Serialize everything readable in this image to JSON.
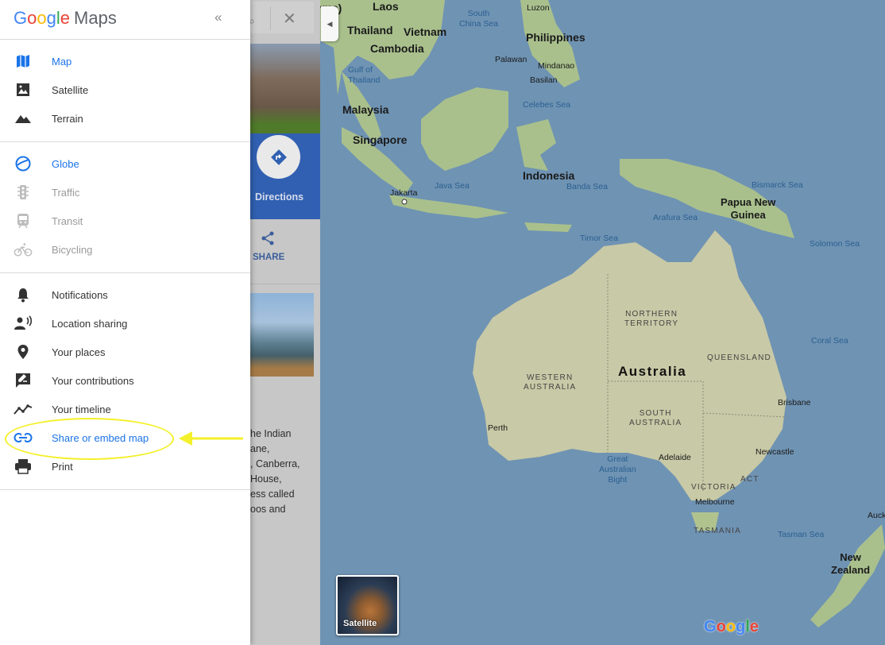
{
  "drawer": {
    "logo_google": [
      "G",
      "o",
      "o",
      "g",
      "l",
      "e"
    ],
    "logo_maps": "Maps",
    "collapse_icon": "«",
    "map_types": [
      {
        "label": "Map",
        "icon": "map-icon",
        "active": true
      },
      {
        "label": "Satellite",
        "icon": "satellite-icon",
        "active": false
      },
      {
        "label": "Terrain",
        "icon": "terrain-icon",
        "active": false
      }
    ],
    "layers": [
      {
        "label": "Globe",
        "icon": "globe-icon",
        "active": true
      },
      {
        "label": "Traffic",
        "icon": "traffic-icon",
        "disabled": true
      },
      {
        "label": "Transit",
        "icon": "transit-icon",
        "disabled": true
      },
      {
        "label": "Bicycling",
        "icon": "bicycle-icon",
        "disabled": true
      }
    ],
    "account": [
      {
        "label": "Notifications",
        "icon": "bell-icon"
      },
      {
        "label": "Location sharing",
        "icon": "location-sharing-icon"
      },
      {
        "label": "Your places",
        "icon": "pin-icon"
      },
      {
        "label": "Your contributions",
        "icon": "contributions-icon"
      },
      {
        "label": "Your timeline",
        "icon": "timeline-icon"
      },
      {
        "label": "Share or embed map",
        "icon": "link-icon",
        "active": true
      },
      {
        "label": "Print",
        "icon": "print-icon"
      }
    ]
  },
  "panel": {
    "directions_label": "Directions",
    "share_label": "SHARE",
    "description_lines": [
      "he Indian",
      "ane,",
      ", Canberra,",
      " House,",
      "ess called",
      "oos and"
    ]
  },
  "map": {
    "labels": {
      "laos": "Laos",
      "burma": "rma)",
      "thailand": "Thailand",
      "vietnam": "Vietnam",
      "cambodia": "Cambodia",
      "south_china_sea": "South\nChina Sea",
      "luzon": "Luzon",
      "philippines": "Philippines",
      "palawan": "Palawan",
      "mindanao": "Mindanao",
      "basilan": "Basilan",
      "gulf_of_thailand": "Gulf of\nThailand",
      "malaysia": "Malaysia",
      "celebes_sea": "Celebes Sea",
      "singapore": "Singapore",
      "indonesia": "Indonesia",
      "jakarta": "Jakarta",
      "java_sea": "Java Sea",
      "banda_sea": "Banda Sea",
      "bismarck_sea": "Bismarck Sea",
      "papua_new_guinea": "Papua New\nGuinea",
      "arafura_sea": "Arafura Sea",
      "timor_sea": "Timor Sea",
      "solomon_sea": "Solomon Sea",
      "northern_territory": "NORTHERN\nTERRITORY",
      "coral_sea": "Coral Sea",
      "queensland": "QUEENSLAND",
      "western_australia": "WESTERN\nAUSTRALIA",
      "australia": "Australia",
      "brisbane": "Brisbane",
      "south_australia": "SOUTH\nAUSTRALIA",
      "perth": "Perth",
      "newcastle": "Newcastle",
      "great_australian_bight": "Great\nAustralian\nBight",
      "adelaide": "Adelaide",
      "act": "ACT",
      "victoria": "VICTORIA",
      "melbourne": "Melbourne",
      "tasmania": "TASMANIA",
      "tasman_sea": "Tasman Sea",
      "auck": "Auck",
      "new_zealand": "New\nZealand"
    },
    "satellite_thumb_label": "Satellite",
    "watermark": [
      "G",
      "o",
      "o",
      "g",
      "l",
      "e"
    ]
  },
  "colors": {
    "active_blue": "#1a73e8",
    "water": "#6f93b3",
    "land": "#b8c9a0",
    "annotation": "#f4f02a"
  }
}
